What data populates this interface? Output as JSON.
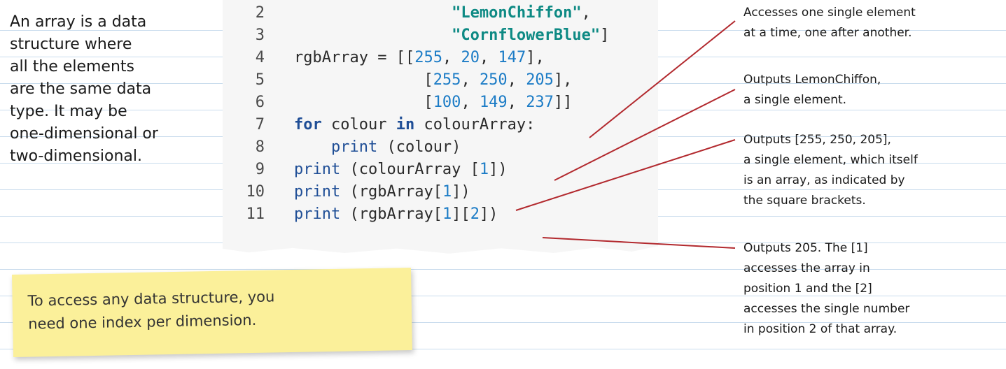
{
  "intro": {
    "lines": [
      "An array is a data",
      "structure where",
      "all the elements",
      "are the same data",
      "type. It may be",
      "one-dimensional or",
      "two-dimensional."
    ]
  },
  "code": {
    "line_numbers": [
      "2",
      "3",
      "4",
      "5",
      "6",
      "7",
      "8",
      "9",
      "10",
      "11"
    ],
    "tokens": {
      "str_lemon": "\"LemonChiffon\"",
      "str_cornflower": "\"CornflowerBlue\"",
      "rgb_name": "rgbArray",
      "kw_for": "for",
      "kw_in": "in",
      "print": "print"
    }
  },
  "annotations": [
    {
      "lines": [
        "Accesses one single element",
        "at a time, one after another."
      ]
    },
    {
      "lines": [
        "Outputs LemonChiffon,",
        "a single element."
      ]
    },
    {
      "lines": [
        "Outputs [255, 250, 205],",
        "a single element, which itself",
        "is an array, as indicated by",
        "the square brackets."
      ]
    },
    {
      "lines": [
        "Outputs 205. The [1]",
        "accesses the array in",
        "position 1 and the [2]",
        "accesses the single number",
        "in position 2 of that array."
      ]
    }
  ],
  "sticky_note": {
    "lines": [
      "To access any data structure, you",
      "need one index per dimension."
    ]
  },
  "colors": {
    "keyword": "#1f4e96",
    "number": "#1c7cc6",
    "string": "#0e8a84",
    "connector": "#b2292e",
    "sticky": "#fbf09a",
    "ruled_line": "#c9dced"
  }
}
